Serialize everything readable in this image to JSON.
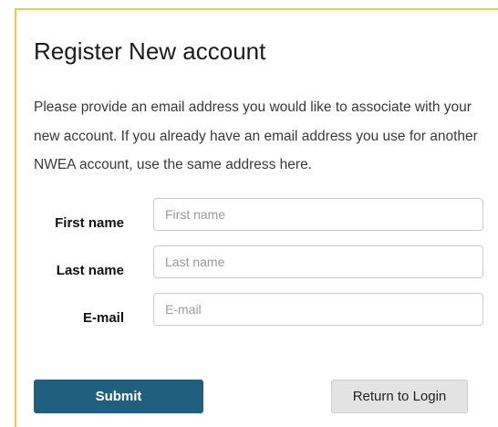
{
  "form": {
    "title": "Register New account",
    "intro": "Please provide an email address you would like to associate with your new account. If you already have an email address you use for another NWEA account, use the same address here.",
    "fields": [
      {
        "label": "First name",
        "placeholder": "First name",
        "value": ""
      },
      {
        "label": "Last name",
        "placeholder": "Last name",
        "value": ""
      },
      {
        "label": "E-mail",
        "placeholder": "E-mail",
        "value": ""
      }
    ],
    "submit_label": "Submit",
    "return_label": "Return to Login"
  },
  "colors": {
    "accent_border": "#f2c94c",
    "submit_bg": "#215f7f",
    "return_bg": "#e3e3e3"
  }
}
